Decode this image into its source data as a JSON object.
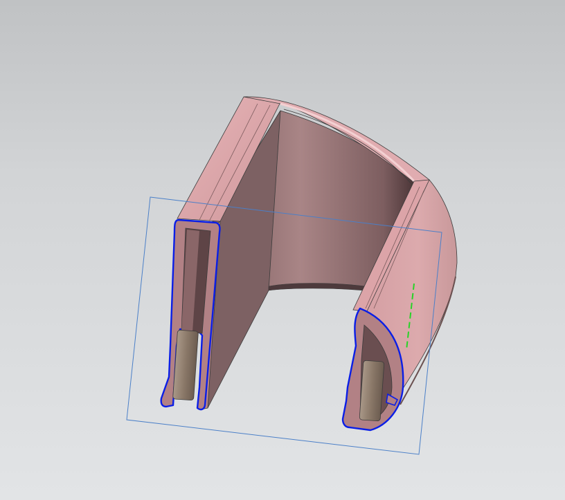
{
  "viewport": {
    "background_top": "#c0c2c4",
    "background_bottom": "#e2e4e6"
  },
  "model": {
    "body_color": "#d8a2a6",
    "inner_wall_color": "#8a6a6c",
    "shadow_color": "#5c4446",
    "insert_color": "#8c7a6a",
    "outline_color": "#3b3b3b"
  },
  "sketch_plane": {
    "color": "#4a7fc8"
  },
  "selection_highlight": {
    "color": "#0a1ee6"
  },
  "axis_indicator": {
    "color": "#27d327"
  }
}
